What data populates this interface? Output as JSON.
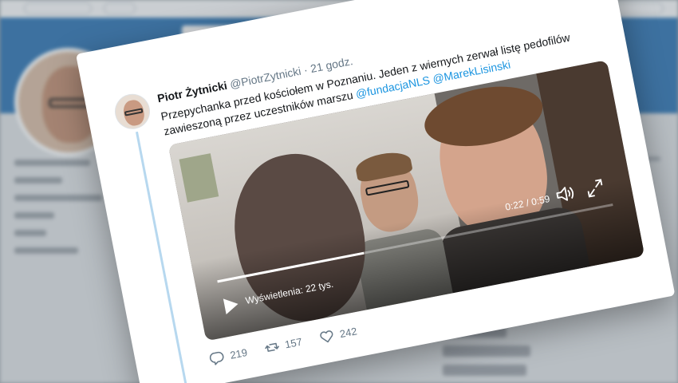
{
  "tweet": {
    "author_name": "Piotr Żytnicki",
    "author_handle": "@PiotrZytnicki",
    "time": "· 21 godz.",
    "text_before": "Przepychanka przed kościołem w Poznaniu. Jeden z wiernych zerwał listę pedofilów zawieszoną przez uczestników marszu ",
    "mention_1": "@fundacjaNLS",
    "mention_2": "@MarekLisinski"
  },
  "video": {
    "duration": "0:22 / 0:59",
    "views": "Wyświetlenia: 22 tys.",
    "progress": 0.37
  },
  "actions": {
    "replies": "219",
    "retweets": "157",
    "likes": "242"
  },
  "colors": {
    "banner": "#3d7bb3",
    "mention": "#1b95e0",
    "thread_line": "#b7d8ef"
  }
}
